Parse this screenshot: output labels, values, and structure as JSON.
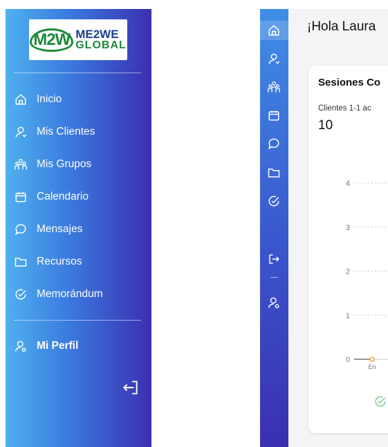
{
  "sidebar": {
    "logo": {
      "mark": "M2W",
      "line1": "ME2WE",
      "line2": "GLOBAL"
    },
    "items": [
      {
        "label": "Inicio",
        "icon": "home-icon"
      },
      {
        "label": "Mis Clientes",
        "icon": "user-icon"
      },
      {
        "label": "Mis Grupos",
        "icon": "group-icon"
      },
      {
        "label": "Calendario",
        "icon": "calendar-icon"
      },
      {
        "label": "Mensajes",
        "icon": "message-icon"
      },
      {
        "label": "Recursos",
        "icon": "folder-icon"
      },
      {
        "label": "Memorándum",
        "icon": "check-circle-icon"
      }
    ],
    "profile": {
      "label": "Mi Perfil",
      "icon": "user-settings-icon"
    },
    "logout_icon": "logout-icon"
  },
  "main": {
    "greeting": "¡Hola Laura",
    "card": {
      "title": "Sesiones Co",
      "metric_label": "Clientes 1-1 ac",
      "metric_value": "10",
      "footer_icon": "check-circle-icon"
    }
  },
  "chart_data": {
    "type": "line",
    "yticks": [
      "0",
      "1",
      "2",
      "3",
      "4"
    ],
    "ylim": [
      0,
      4
    ],
    "x": [
      "En"
    ],
    "series": [
      {
        "values": [
          0
        ]
      }
    ],
    "grid": true
  },
  "colors": {
    "sidebar_start": "#4fb1ee",
    "sidebar_end": "#3a2fb0",
    "logo_green": "#1d8a3a",
    "logo_blue": "#1d3f8a",
    "point_color": "#f0a030"
  }
}
